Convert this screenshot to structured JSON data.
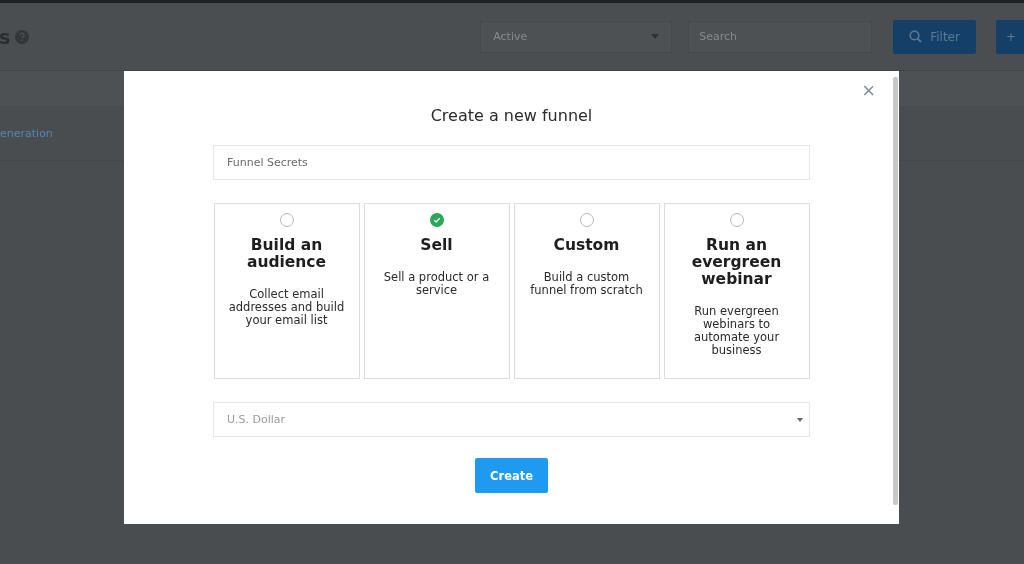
{
  "page": {
    "title": "s",
    "status_filter": "Active",
    "search": {
      "placeholder": "Search"
    },
    "filter_button": "Filter",
    "add_button": "+",
    "row_link": "eneration"
  },
  "modal": {
    "title": "Create a new funnel",
    "close": "×",
    "name_field": {
      "value": "Funnel Secrets"
    },
    "options": [
      {
        "title": "Build an audience",
        "description": "Collect email addresses and build your email list",
        "selected": false
      },
      {
        "title": "Sell",
        "description": "Sell a product or a service",
        "selected": true
      },
      {
        "title": "Custom",
        "description": "Build a custom funnel from scratch",
        "selected": false
      },
      {
        "title": "Run an evergreen webinar",
        "description": "Run evergreen webinars to automate your business",
        "selected": false
      }
    ],
    "currency": {
      "value": "U.S. Dollar"
    },
    "create_button": "Create"
  }
}
